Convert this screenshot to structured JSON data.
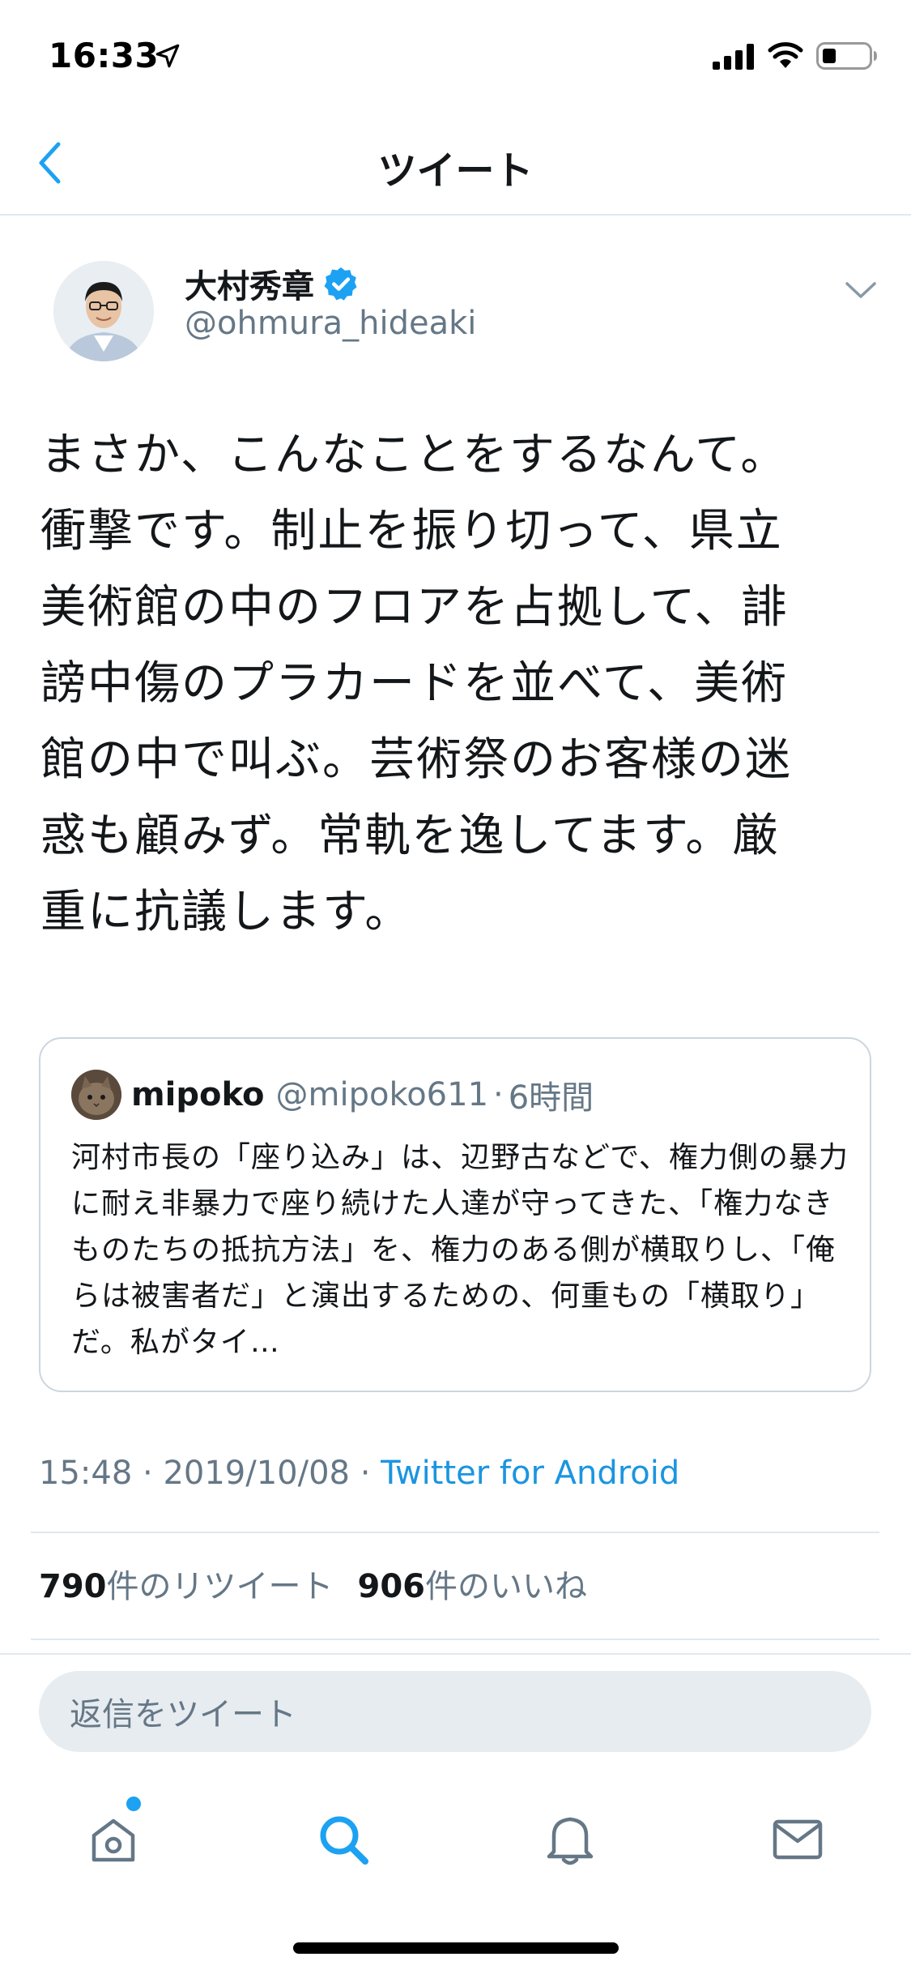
{
  "status_bar": {
    "time": "16:33"
  },
  "header": {
    "title": "ツイート"
  },
  "tweet": {
    "author_name": "大村秀章",
    "author_handle": "@ohmura_hideaki",
    "text": "まさか、こんなことをするなんて。\n衝撃です。制止を振り切って、県立\n美術館の中のフロアを占拠して、誹\n謗中傷のプラカードを並べて、美術\n館の中で叫ぶ。芸術祭のお客様の迷\n惑も顧みず。常軌を逸してます。厳\n重に抗議します。",
    "quoted": {
      "name": "mipoko",
      "handle": "@mipoko611",
      "separator": "·",
      "time": "6時間",
      "text": "河村市長の「座り込み」は、辺野古などで、権力側の暴力に耐え非暴力で座り続けた人達が守ってきた、「権力なきものたちの抵抗方法」を、権力のある側が横取りし、「俺らは被害者だ」と演出するための、何重もの「横取り」だ。私がタイ…"
    },
    "meta": {
      "time": "15:48",
      "separator": " · ",
      "date": "2019/10/08",
      "source": "Twitter for Android"
    },
    "stats": {
      "retweet_count": "790",
      "retweet_label": "件のリツイート",
      "like_count": "906",
      "like_label": "件のいいね"
    }
  },
  "reply": {
    "placeholder": "返信をツイート"
  },
  "tab_bar": {
    "items": [
      "home",
      "search",
      "notifications",
      "messages"
    ],
    "active": "search"
  },
  "colors": {
    "accent": "#1DA1F2",
    "link": "#1B95E0",
    "text_primary": "#14171A",
    "text_secondary": "#657786",
    "border": "#E1E8ED",
    "input_bg": "#E6ECF0"
  }
}
